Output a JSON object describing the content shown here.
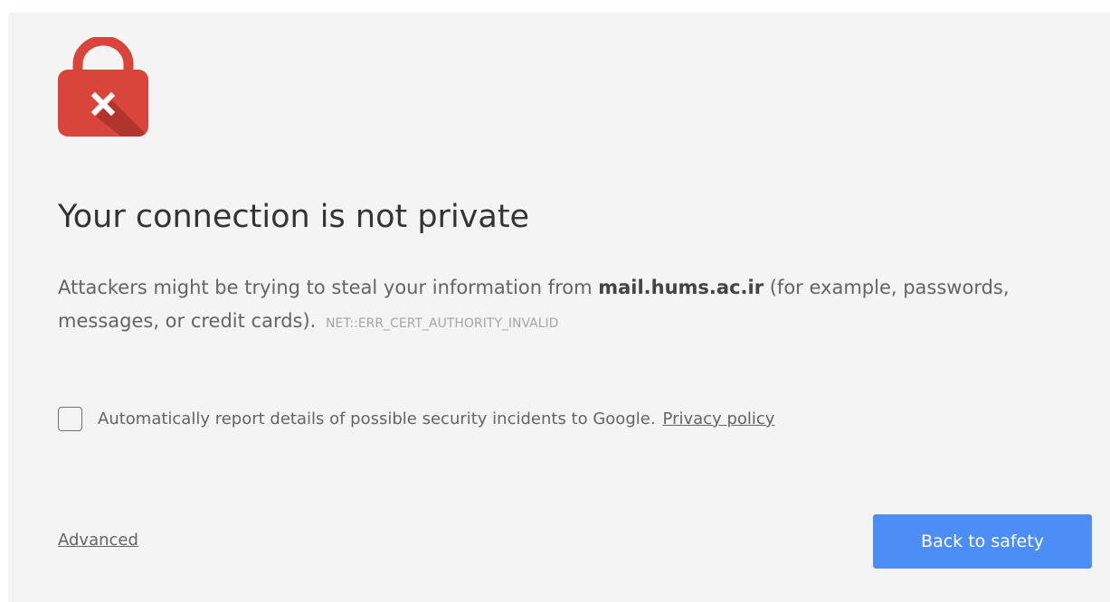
{
  "icon": {
    "name": "lock-error-icon",
    "color": "#d9453b",
    "shadow_color": "#b2352d",
    "mark_color": "#ffffff"
  },
  "title": "Your connection is not private",
  "message": {
    "before_host": "Attackers might be trying to steal your information from ",
    "host": "mail.hums.ac.ir",
    "after_host": " (for example, passwords, messages, or credit cards).",
    "error_code": "NET::ERR_CERT_AUTHORITY_INVALID"
  },
  "report": {
    "checked": false,
    "label": "Automatically report details of possible security incidents to Google.",
    "link_label": "Privacy policy"
  },
  "advanced_label": "Advanced",
  "back_button_label": "Back to safety",
  "colors": {
    "background": "#f4f4f4",
    "accent": "#4c8ef5",
    "text": "#646464",
    "heading": "#333333"
  }
}
